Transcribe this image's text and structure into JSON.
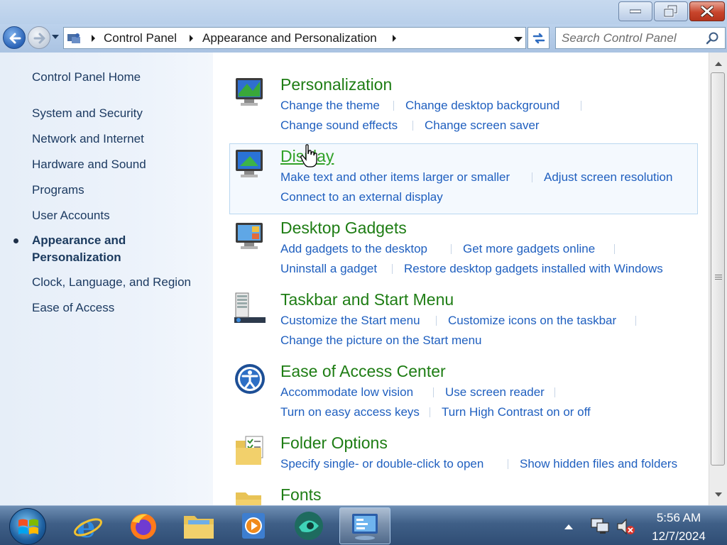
{
  "window": {
    "buttons": [
      "minimize",
      "maximize",
      "close"
    ]
  },
  "address_bar": {
    "icon": "control-panel-icon",
    "breadcrumbs": [
      "Control Panel",
      "Appearance and Personalization"
    ]
  },
  "search": {
    "placeholder": "Search Control Panel",
    "icon": "search-icon"
  },
  "sidebar": {
    "home": "Control Panel Home",
    "items": [
      {
        "label": "System and Security"
      },
      {
        "label": "Network and Internet"
      },
      {
        "label": "Hardware and Sound"
      },
      {
        "label": "Programs"
      },
      {
        "label": "User Accounts"
      },
      {
        "label": "Appearance and Personalization",
        "active": true
      },
      {
        "label": "Clock, Language, and Region"
      },
      {
        "label": "Ease of Access"
      }
    ]
  },
  "categories": [
    {
      "title": "Personalization",
      "icon": "personalization-monitor-icon",
      "links": [
        "Change the theme",
        "Change desktop background",
        "Change sound effects",
        "Change screen saver"
      ]
    },
    {
      "title": "Display",
      "icon": "display-monitor-icon",
      "hovered": true,
      "links": [
        "Make text and other items larger or smaller",
        "Adjust screen resolution",
        "Connect to an external display"
      ]
    },
    {
      "title": "Desktop Gadgets",
      "icon": "desktop-gadgets-icon",
      "links": [
        "Add gadgets to the desktop",
        "Get more gadgets online",
        "Uninstall a gadget",
        "Restore desktop gadgets installed with Windows"
      ]
    },
    {
      "title": "Taskbar and Start Menu",
      "icon": "taskbar-icon",
      "links": [
        "Customize the Start menu",
        "Customize icons on the taskbar",
        "Change the picture on the Start menu"
      ]
    },
    {
      "title": "Ease of Access Center",
      "icon": "ease-of-access-icon",
      "links": [
        "Accommodate low vision",
        "Use screen reader",
        "Turn on easy access keys",
        "Turn High Contrast on or off"
      ]
    },
    {
      "title": "Folder Options",
      "icon": "folder-options-icon",
      "links": [
        "Specify single- or double-click to open",
        "Show hidden files and folders"
      ]
    },
    {
      "title": "Fonts",
      "icon": "fonts-folder-icon",
      "links": []
    }
  ],
  "taskbar": {
    "apps": [
      "internet-explorer-icon",
      "firefox-icon",
      "file-explorer-icon",
      "media-player-icon",
      "app-icon",
      "control-panel-icon"
    ],
    "tray_icons": [
      "show-hidden-icons-arrow",
      "network-icon",
      "volume-muted-icon"
    ],
    "time": "5:56 AM",
    "date": "12/7/2024"
  },
  "colors": {
    "category_title": "#1e7d14",
    "link": "#1f5fbf",
    "sidebar_text": "#1c3a61",
    "sidebar_bg": "#e6eef8"
  }
}
